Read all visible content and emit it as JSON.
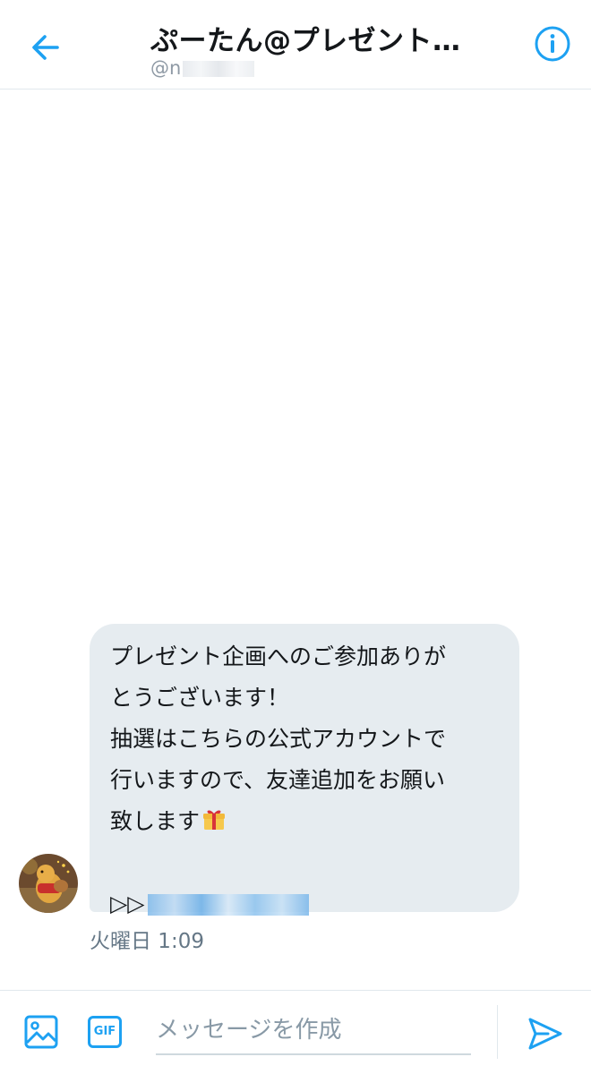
{
  "header": {
    "title": "ぷーたん@プレゼント…",
    "handle_prefix": "@n",
    "back_icon": "arrow-left-icon",
    "info_icon": "info-circle-icon"
  },
  "message": {
    "lines": [
      "プレゼント企画へのご参加ありが",
      "とうございます！",
      "抽選はこちらの公式アカウントで",
      "行いますので、友達追加をお願い",
      "致します"
    ],
    "emoji": "gift-icon",
    "link_prefix": "▷▷",
    "timestamp": "火曜日 1:09"
  },
  "composer": {
    "placeholder": "メッセージを作成",
    "gif_label": "GIF",
    "media_icon": "image-icon",
    "send_icon": "send-icon"
  },
  "colors": {
    "accent": "#1da1f2",
    "bubble": "#e6ecf0",
    "muted_text": "#657786"
  }
}
